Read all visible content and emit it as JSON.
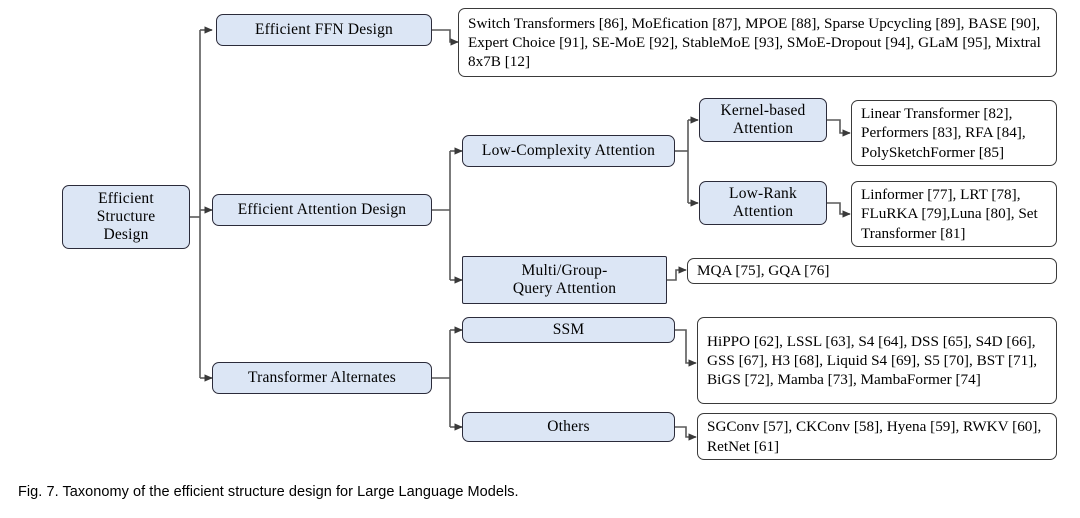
{
  "figure": {
    "caption": "Fig. 7. Taxonomy of the efficient structure design for Large Language Models.",
    "root_label": "Efficient\nStructure\nDesign"
  },
  "colors": {
    "node_fill": "#dce6f5",
    "node_border": "#2b2b3a",
    "leaf_fill": "#ffffff",
    "leaf_border": "#3a3a3a",
    "edge": "#5a5a5a",
    "text": "#000000",
    "background": "#ffffff"
  },
  "nodes": {
    "efficient_ffn_design": "Efficient FFN Design",
    "efficient_attention_design": "Efficient Attention Design",
    "transformer_alternates": "Transformer Alternates",
    "low_complexity_attention": "Low-Complexity Attention",
    "multi_group_query_attention": "Multi/Group-\nQuery Attention",
    "kernel_based_attention": "Kernel-based\nAttention",
    "low_rank_attention": "Low-Rank\nAttention",
    "ssm": "SSM",
    "others": "Others"
  },
  "leaves": {
    "ffn_methods": "Switch Transformers [86], MoEfication [87], MPOE [88], Sparse Upcycling [89], BASE [90], Expert Choice [91], SE-MoE [92], StableMoE [93], SMoE-Dropout [94], GLaM [95], Mixtral 8x7B [12]",
    "kernel_based_methods": "Linear Transformer [82], Performers [83], RFA [84], PolySketchFormer [85]",
    "low_rank_methods": "Linformer [77], LRT [78], FLuRKA [79],Luna [80], Set Transformer [81]",
    "multi_group_query_methods": "MQA [75], GQA [76]",
    "ssm_methods": "HiPPO [62], LSSL [63], S4 [64], DSS [65], S4D [66], GSS [67], H3 [68], Liquid S4 [69], S5 [70], BST [71], BiGS [72], Mamba [73], MambaFormer [74]",
    "others_methods": "SGConv [57], CKConv [58], Hyena [59], RWKV [60], RetNet [61]"
  }
}
